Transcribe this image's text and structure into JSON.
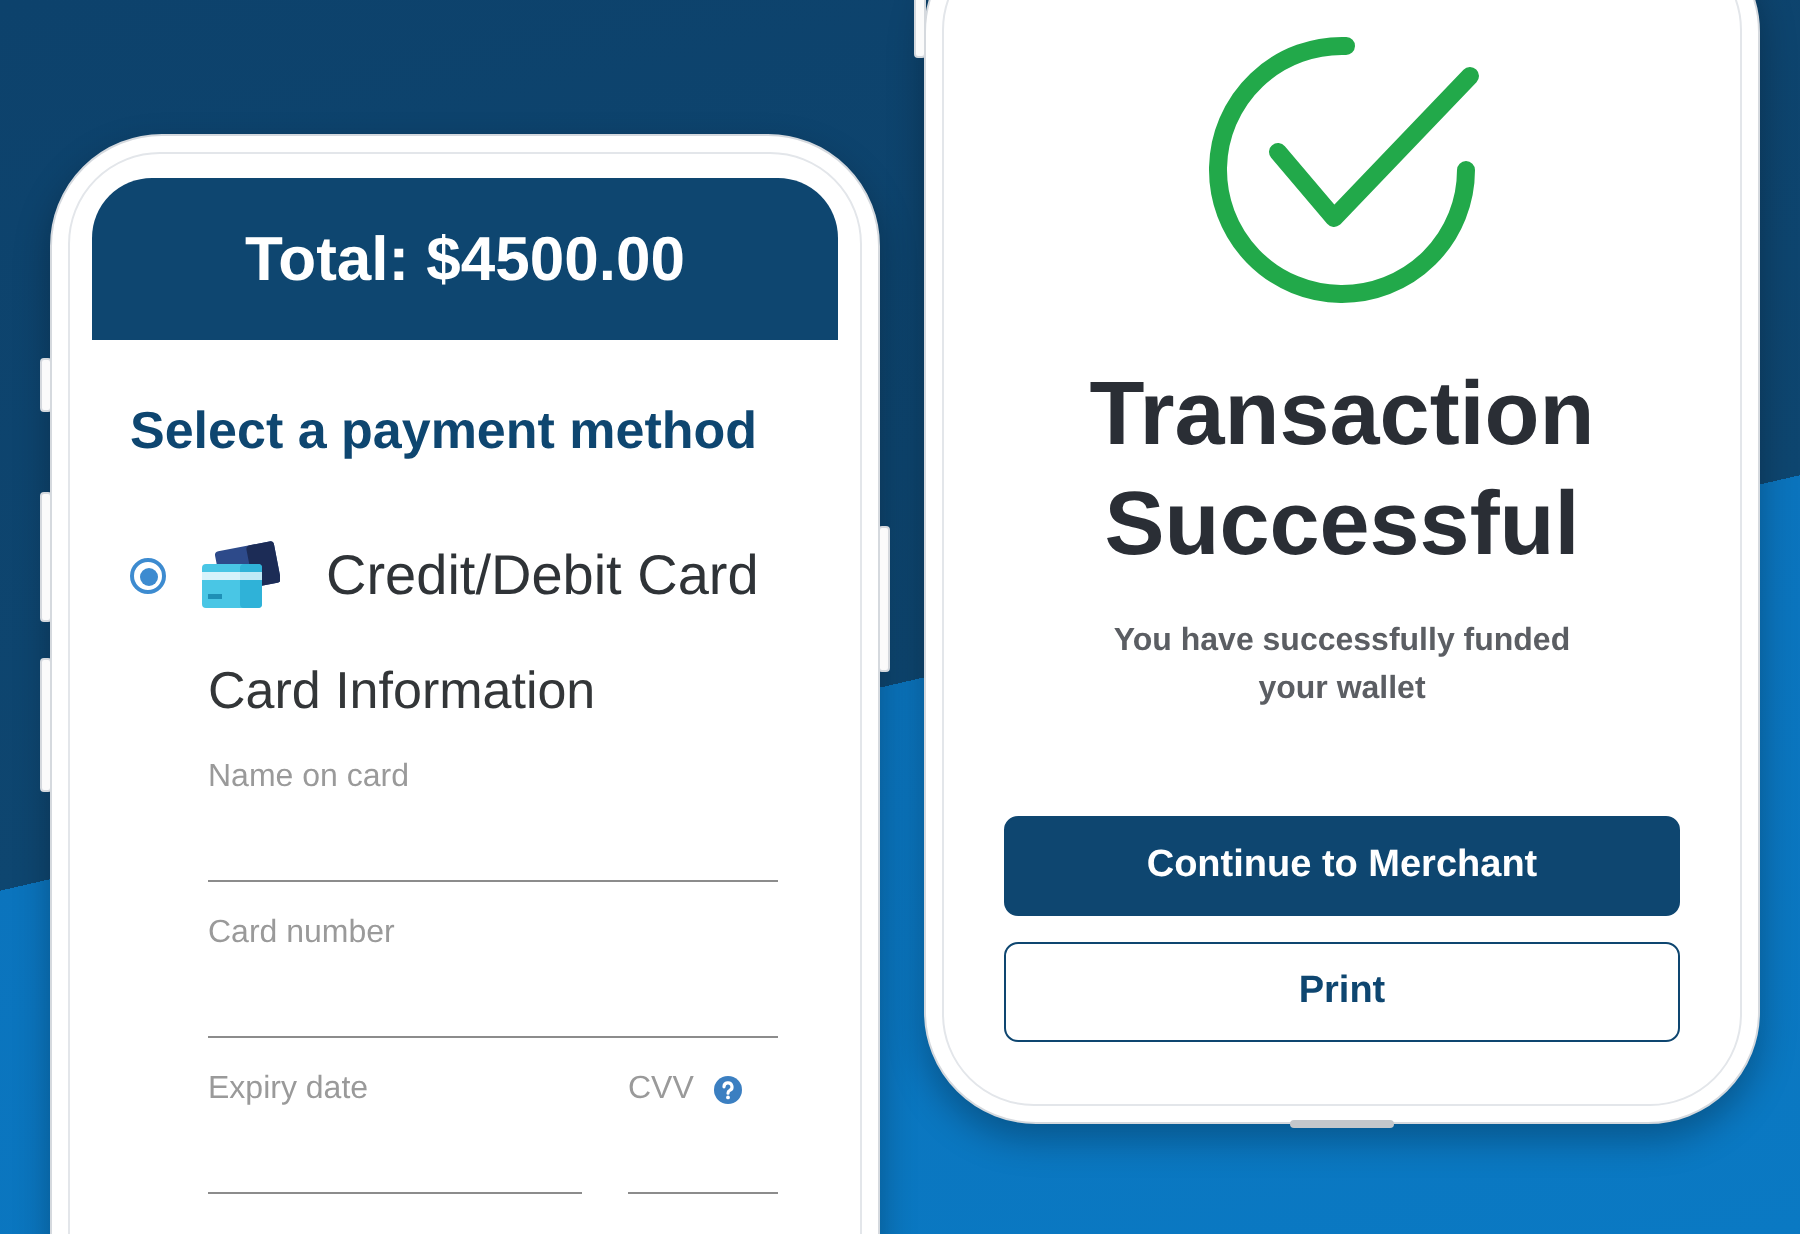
{
  "payment_phone": {
    "header": {
      "total": "Total: $4500.00"
    },
    "title": "Select a payment method",
    "methods": [
      {
        "label": "Credit/Debit Card",
        "selected": true
      }
    ],
    "card_form": {
      "title": "Card Information",
      "fields": [
        {
          "label": "Name on card",
          "kind": "full"
        },
        {
          "label": "Card number",
          "kind": "full"
        },
        {
          "label": "Expiry date",
          "kind": "half"
        },
        {
          "label": "CVV",
          "kind": "short",
          "help": true
        }
      ]
    }
  },
  "success_phone": {
    "title": "Transaction Successful",
    "message": "You have successfully funded your wallet",
    "buttons": [
      {
        "label": "Continue to Merchant",
        "kind": "primary"
      },
      {
        "label": "Print",
        "kind": "secondary"
      }
    ]
  }
}
